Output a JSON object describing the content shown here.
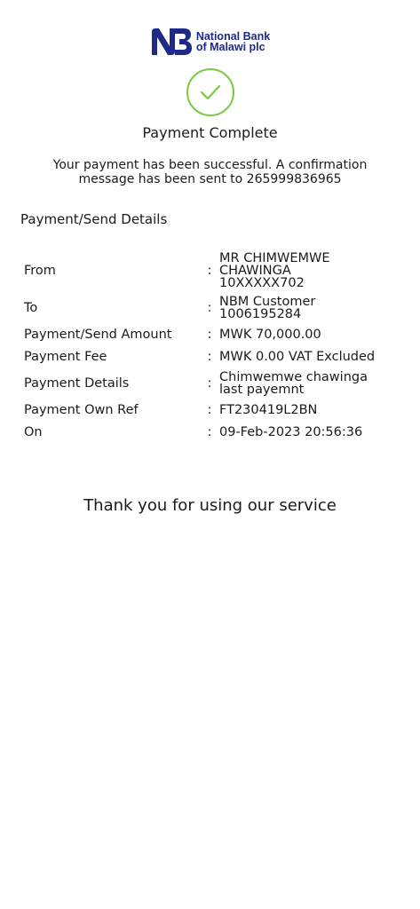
{
  "brand": {
    "line1": "National Bank",
    "line2": "of Malawi plc",
    "color": "#1f2a86"
  },
  "status": {
    "icon": "check-icon",
    "color": "#7ac943"
  },
  "title": "Payment Complete",
  "message": "Your payment has been successful. A confirmation message has been sent to 265999836965",
  "section_title": "Payment/Send Details",
  "details": [
    {
      "label": "From",
      "colon": ":",
      "value_lines": [
        "MR CHIMWEMWE",
        "CHAWINGA",
        "10XXXXX702"
      ]
    },
    {
      "label": "To",
      "colon": ":",
      "value_lines": [
        "NBM Customer",
        "1006195284"
      ]
    },
    {
      "label": "Payment/Send Amount",
      "colon": ":",
      "value_lines": [
        "MWK 70,000.00"
      ]
    },
    {
      "label": "Payment Fee",
      "colon": ":",
      "value_lines": [
        "MWK 0.00 VAT Excluded"
      ]
    },
    {
      "label": "Payment Details",
      "colon": ":",
      "value_lines": [
        "Chimwemwe chawinga",
        "last payemnt"
      ]
    },
    {
      "label": "Payment Own Ref",
      "colon": ":",
      "value_lines": [
        "FT230419L2BN"
      ]
    },
    {
      "label": "On",
      "colon": ":",
      "value_lines": [
        "09-Feb-2023 20:56:36"
      ]
    }
  ],
  "thanks": "Thank you for using our service"
}
